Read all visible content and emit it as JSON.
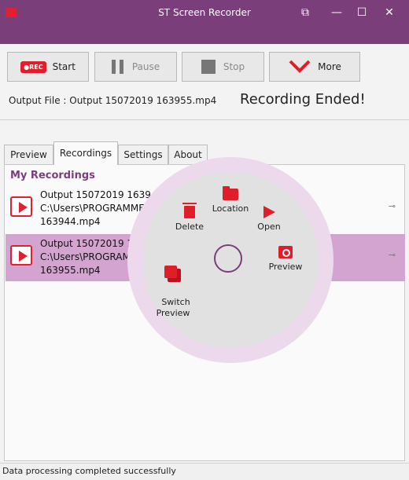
{
  "window": {
    "title": "ST Screen Recorder",
    "controls": [
      "restore-down",
      "minimize",
      "maximize",
      "close"
    ]
  },
  "toolbar": {
    "start_label": "Start",
    "rec_badge": "●REC",
    "pause_label": "Pause",
    "stop_label": "Stop",
    "more_label": "More"
  },
  "output_file": "Output File : Output 15072019 163955.mp4",
  "recording_status": "Recording Ended!",
  "tabs": [
    {
      "label": "Preview"
    },
    {
      "label": "Recordings",
      "active": true
    },
    {
      "label": "Settings"
    },
    {
      "label": "About"
    }
  ],
  "recordings": {
    "section_title": "My Recordings",
    "items": [
      {
        "text": "Output 15072019 163944\nC:\\Users\\PROGRAMME                                    019\n163944.mp4",
        "selected": false
      },
      {
        "text": "Output 15072019 16\nC:\\Users\\PROGRAM\n163955.mp4",
        "selected": true
      }
    ]
  },
  "context_menu": {
    "items": [
      {
        "label": "Location",
        "icon": "folder-icon"
      },
      {
        "label": "Delete",
        "icon": "trash-icon"
      },
      {
        "label": "Open",
        "icon": "play-icon"
      },
      {
        "label": "Switch\nPreview",
        "icon": "switch-preview-icon"
      },
      {
        "label": "Preview",
        "icon": "eye-icon"
      }
    ]
  },
  "status_bar": "Data processing completed successfully",
  "colors": {
    "titlebar": "#7a3e7a",
    "accent_red": "#e01e2a",
    "selection": "#d3a4cf",
    "menu_ring": "#ecd9ec"
  }
}
